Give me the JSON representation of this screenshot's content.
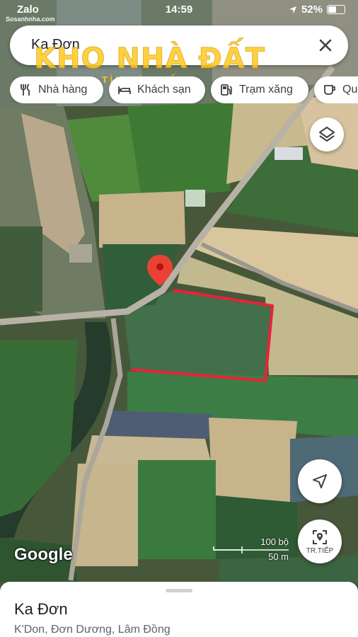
{
  "status_bar": {
    "carrier": "Zalo",
    "time": "14:59",
    "battery": "52%"
  },
  "watermark": {
    "site": "Sosanhnha.com",
    "main": "KHO NHÀ ĐẤT",
    "tagline": "TÌM LÀ THẤY"
  },
  "search": {
    "query": "Ka Đơn"
  },
  "chips": [
    {
      "label": "Nhà hàng",
      "icon": "restaurant-icon"
    },
    {
      "label": "Khách sạn",
      "icon": "hotel-icon"
    },
    {
      "label": "Trạm xăng",
      "icon": "gas-station-icon"
    },
    {
      "label": "Qu",
      "icon": "cafe-icon"
    }
  ],
  "map": {
    "logo": "Google",
    "scale_imperial": "100 bộ",
    "scale_metric": "50 m",
    "next_label": "TR.TIẾP"
  },
  "place": {
    "name": "Ka Đơn",
    "address": "K'Don, Đơn Dương, Lâm Đồng"
  },
  "colors": {
    "pin": "#e94235",
    "boundary": "#e8223a"
  }
}
